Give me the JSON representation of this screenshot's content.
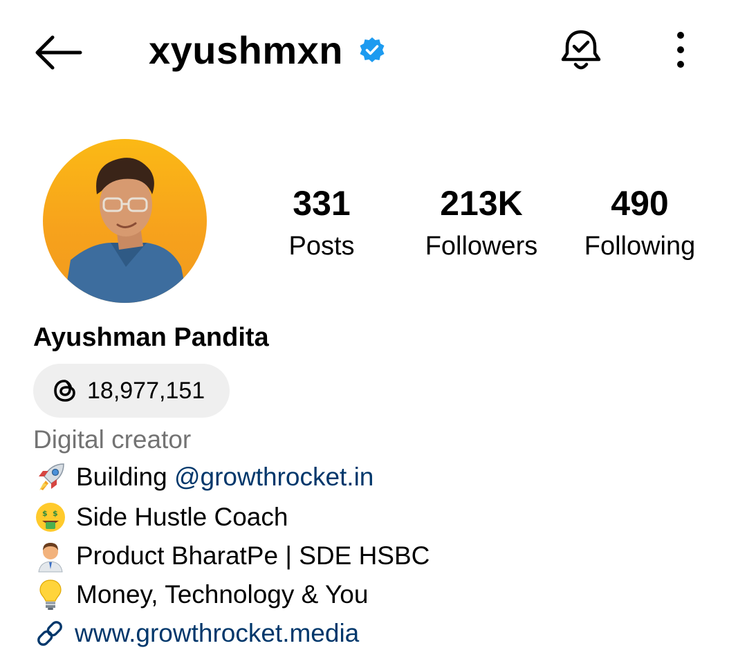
{
  "header": {
    "username": "xyushmxn",
    "icons": {
      "back": "back-arrow-icon",
      "verified": "verified-badge-icon",
      "notifications": "bell-check-icon",
      "more": "more-vertical-icon"
    }
  },
  "stats": [
    {
      "value": "331",
      "label": "Posts"
    },
    {
      "value": "213K",
      "label": "Followers"
    },
    {
      "value": "490",
      "label": "Following"
    }
  ],
  "profile": {
    "full_name": "Ayushman Pandita",
    "threads_count": "18,977,151",
    "category": "Digital creator",
    "bio": {
      "line1_prefix": "Building ",
      "line1_mention": "@growthrocket.in",
      "line2": "Side Hustle Coach",
      "line3": "Product BharatPe | SDE HSBC",
      "line4": "Money, Technology & You"
    },
    "link": "www.growthrocket.media"
  },
  "colors": {
    "verified": "#1d9bf0",
    "link": "#00376b",
    "category": "#737373",
    "pill_bg": "#efefef",
    "avatar_bg": "#f5a51a"
  }
}
